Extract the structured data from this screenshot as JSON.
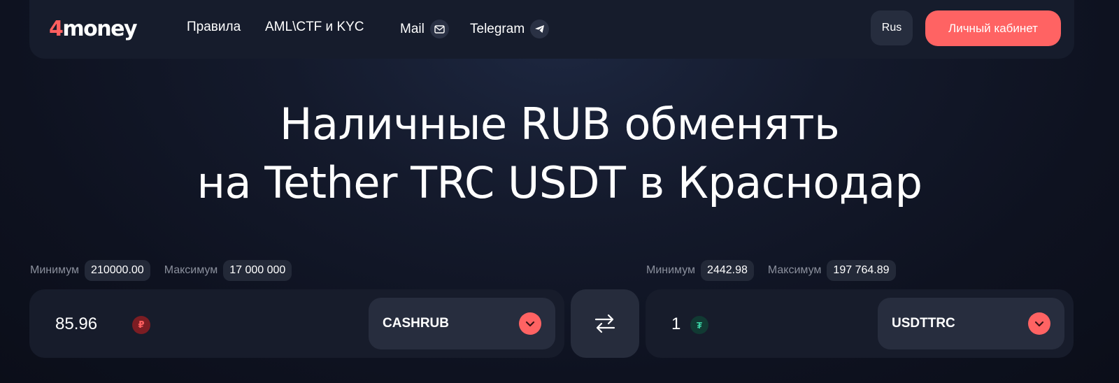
{
  "header": {
    "logo_num": "4",
    "logo_word": "money",
    "nav": [
      {
        "label": "Правила"
      },
      {
        "label": "AML\\CTF и KYC"
      },
      {
        "label": "Mail"
      },
      {
        "label": "Telegram"
      }
    ],
    "lang": "Rus",
    "cabinet": "Личный кабинет"
  },
  "hero": {
    "line1": "Наличные RUB обменять",
    "line2": "на Tether TRC USDT в Краснодар"
  },
  "give": {
    "min_label": "Минимум",
    "min_value": "210000.00",
    "max_label": "Максимум",
    "max_value": "17 000 000",
    "amount": "85.96",
    "coin_symbol": "₽",
    "currency": "CASHRUB"
  },
  "get": {
    "min_label": "Минимум",
    "min_value": "2442.98",
    "max_label": "Максимум",
    "max_value": "197 764.89",
    "amount": "1",
    "coin_symbol": "₮",
    "currency": "USDTTRC"
  },
  "colors": {
    "accent": "#ff6363",
    "background": "#0e1220",
    "panel": "#171c2b"
  }
}
